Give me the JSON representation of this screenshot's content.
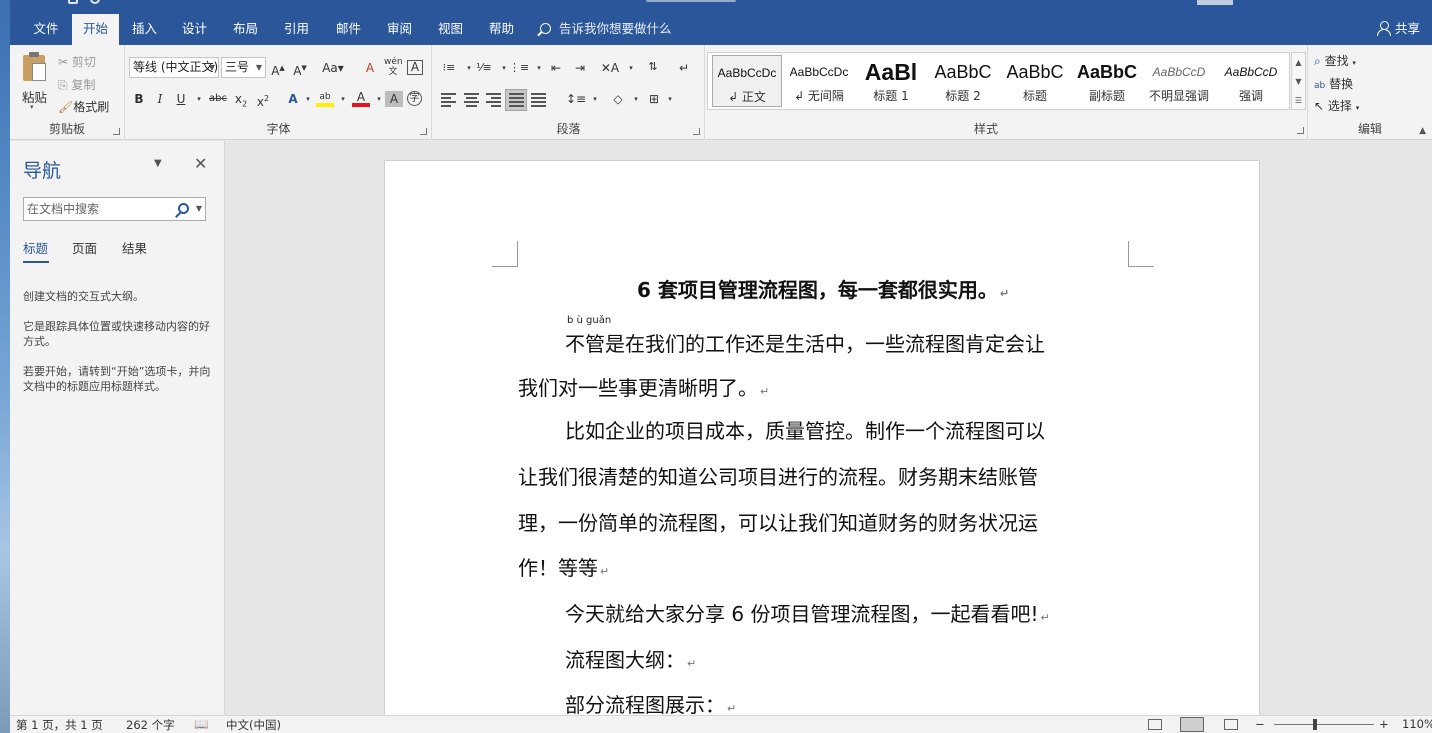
{
  "titlebar": {
    "tabs": [
      "文件",
      "开始",
      "插入",
      "设计",
      "布局",
      "引用",
      "邮件",
      "审阅",
      "视图",
      "帮助"
    ],
    "active_tab": "开始",
    "tell_me": "告诉我你想要做什么",
    "share": "共享"
  },
  "ribbon": {
    "clipboard": {
      "label": "剪贴板",
      "paste": "粘贴",
      "cut": "剪切",
      "copy": "复制",
      "format_painter": "格式刷"
    },
    "font": {
      "label": "字体",
      "font_name": "等线 (中文正文)",
      "font_size": "三号"
    },
    "paragraph": {
      "label": "段落"
    },
    "styles": {
      "label": "样式",
      "items": [
        {
          "sample": "AaBbCcDc",
          "name": "↲ 正文"
        },
        {
          "sample": "AaBbCcDc",
          "name": "↲ 无间隔"
        },
        {
          "sample": "AaBl",
          "name": "标题 1"
        },
        {
          "sample": "AaBbC",
          "name": "标题 2"
        },
        {
          "sample": "AaBbC",
          "name": "标题"
        },
        {
          "sample": "AaBbC",
          "name": "副标题"
        },
        {
          "sample": "AaBbCcD",
          "name": "不明显强调"
        },
        {
          "sample": "AaBbCcD",
          "name": "强调"
        }
      ]
    },
    "editing": {
      "label": "编辑",
      "find": "查找",
      "replace": "替换",
      "select": "选择"
    }
  },
  "nav": {
    "title": "导航",
    "search_placeholder": "在文档中搜索",
    "tabs": [
      "标题",
      "页面",
      "结果"
    ],
    "text1": "创建文档的交互式大纲。",
    "text2": "它是跟踪具体位置或快速移动内容的好方式。",
    "text3": "若要开始，请转到“开始”选项卡，并向文档中的标题应用标题样式。"
  },
  "document": {
    "title": "6 套项目管理流程图，每一套都很实用。",
    "ruby": "b ù guǎn",
    "lines": [
      "不管是在我们的工作还是生活中，一些流程图肯定会让",
      "我们对一些事更清晰明了。",
      "比如企业的项目成本，质量管控。制作一个流程图可以",
      "让我们很清楚的知道公司项目进行的流程。财务期末结账管",
      "理，一份简单的流程图，可以让我们知道财务的财务状况运",
      "作！等等",
      "今天就给大家分享 6 份项目管理流程图，一起看看吧!",
      "流程图大纲：",
      "部分流程图展示："
    ],
    "mark": "↵"
  },
  "status": {
    "page": "第 1 页，共 1 页",
    "words": "262 个字",
    "language": "中文(中国)",
    "zoom": "110%"
  }
}
